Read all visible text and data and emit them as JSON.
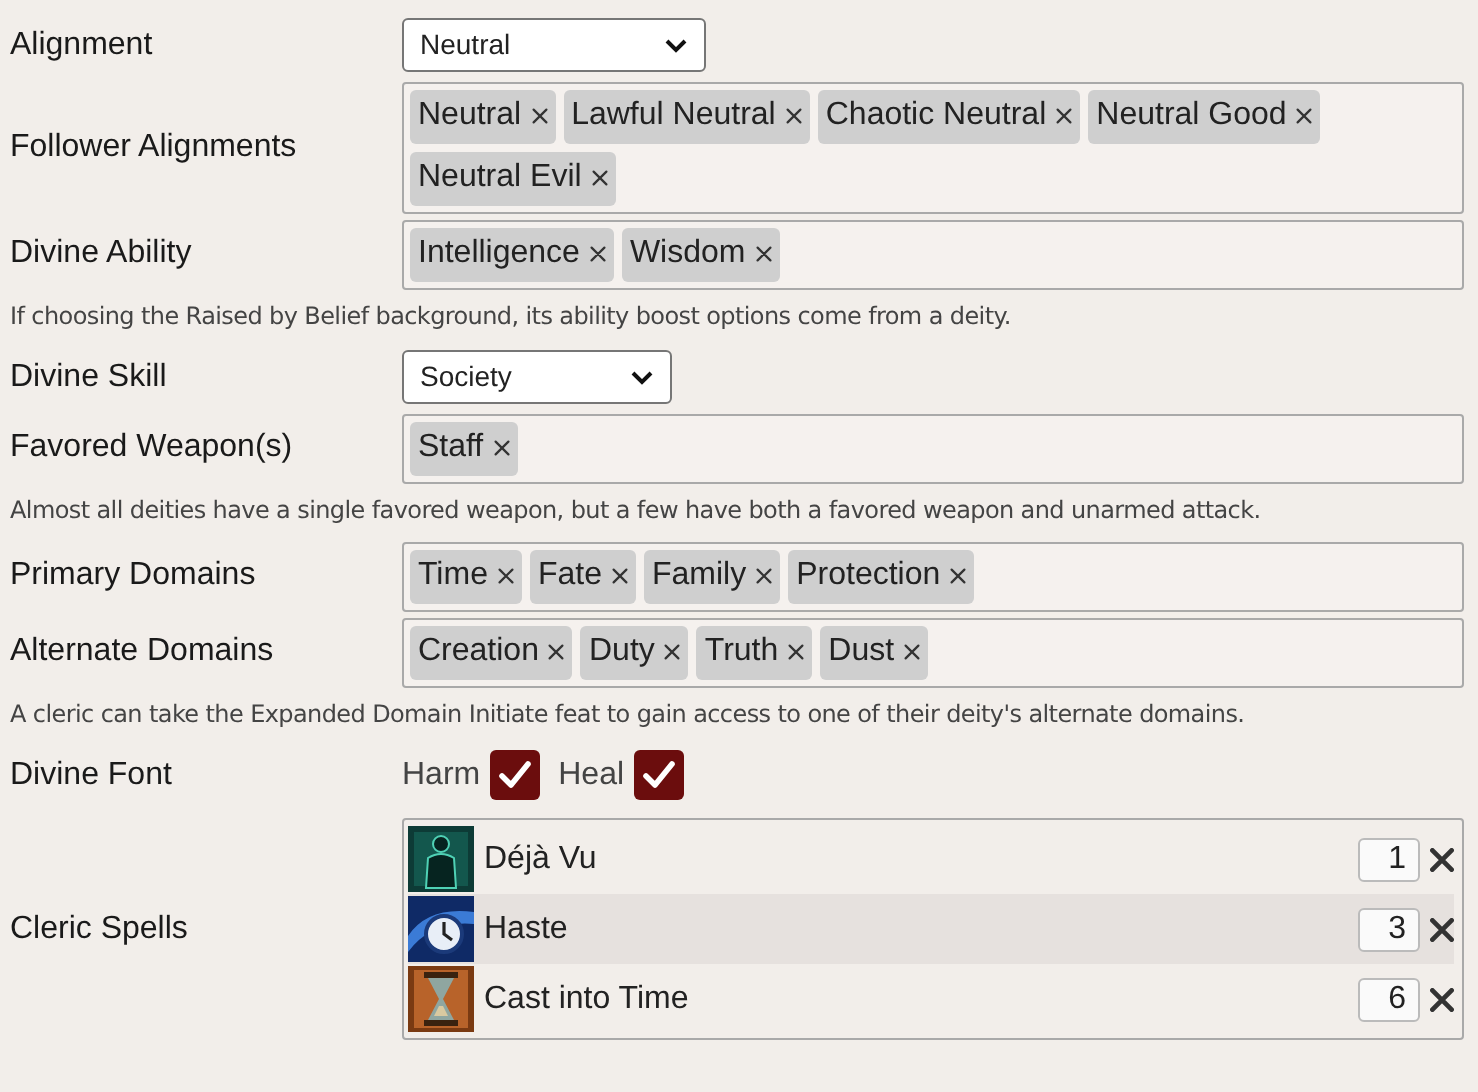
{
  "rows": [
    {
      "kind": "select",
      "label": "Alignment",
      "value": "Neutral"
    },
    {
      "kind": "tags",
      "label": "Follower Alignments",
      "tags": [
        "Neutral",
        "Lawful Neutral",
        "Chaotic Neutral",
        "Neutral Good",
        "Neutral Evil"
      ]
    },
    {
      "kind": "tags",
      "label": "Divine Ability",
      "tags": [
        "Intelligence",
        "Wisdom"
      ]
    },
    {
      "kind": "note",
      "text": "If choosing the Raised by Belief background, its ability boost options come from a deity."
    },
    {
      "kind": "select",
      "label": "Divine Skill",
      "value": "Society"
    },
    {
      "kind": "tags",
      "label": "Favored Weapon(s)",
      "tags": [
        "Staff"
      ]
    },
    {
      "kind": "note",
      "text": "Almost all deities have a single favored weapon, but a few have both a favored weapon and unarmed attack."
    },
    {
      "kind": "tags",
      "label": "Primary Domains",
      "tags": [
        "Time",
        "Fate",
        "Family",
        "Protection"
      ]
    },
    {
      "kind": "tags",
      "label": "Alternate Domains",
      "tags": [
        "Creation",
        "Duty",
        "Truth",
        "Dust"
      ]
    },
    {
      "kind": "note",
      "text": "A cleric can take the Expanded Domain Initiate feat to gain access to one of their deity's alternate domains."
    },
    {
      "kind": "checks",
      "label": "Divine Font",
      "options": [
        {
          "label": "Harm",
          "checked": true
        },
        {
          "label": "Heal",
          "checked": true
        }
      ]
    },
    {
      "kind": "spells",
      "label": "Cleric Spells",
      "spells": [
        {
          "kind": "figure",
          "name": "Déjà Vu",
          "rank": "1",
          "highlighted": false
        },
        {
          "kind": "clock",
          "name": "Haste",
          "rank": "3",
          "highlighted": true
        },
        {
          "kind": "hourglass",
          "name": "Cast into Time",
          "rank": "6",
          "highlighted": false
        }
      ]
    }
  ]
}
